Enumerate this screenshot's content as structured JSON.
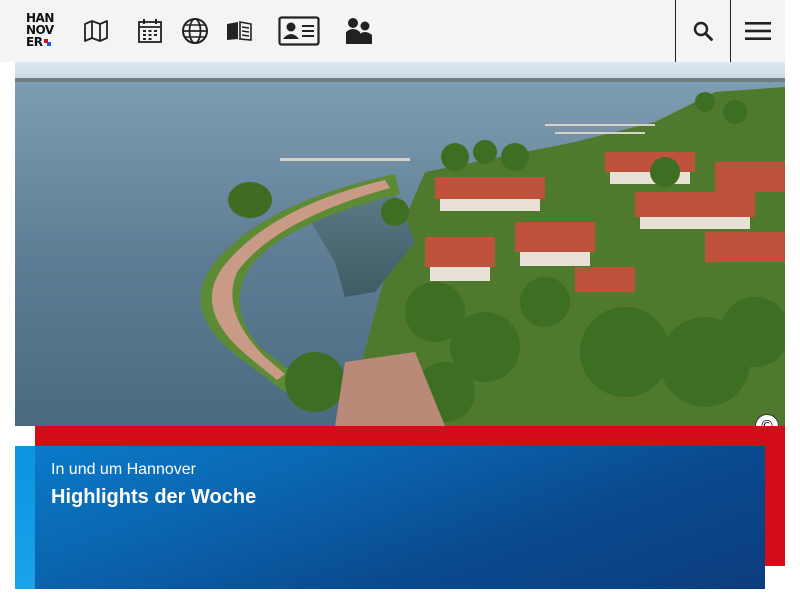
{
  "header": {
    "logo_lines": [
      "HAN",
      "NOV",
      "ER"
    ],
    "icons": [
      "map-icon",
      "calendar-icon",
      "globe-icon",
      "book-icon",
      "id-card-icon",
      "people-icon",
      "search-icon",
      "hamburger-menu-icon"
    ]
  },
  "hero": {
    "copyright_symbol": "©"
  },
  "teaser": {
    "kicker": "In und um Hannover",
    "headline": "Highlights der Woche"
  },
  "colors": {
    "accent_red": "#d40b18",
    "blue_dark": "#0c3d7d",
    "blue_light": "#1aa2ea",
    "header_bg": "#f4f4f4"
  }
}
